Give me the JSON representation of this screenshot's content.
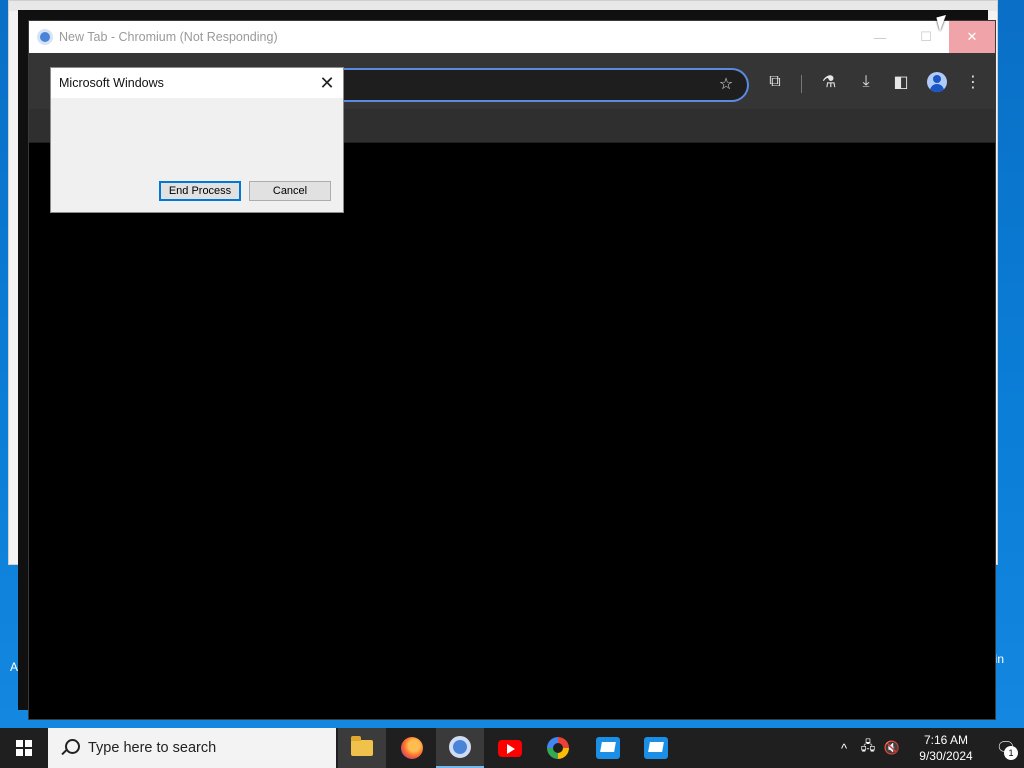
{
  "desktop": {
    "left_edge_text": "A",
    "right_edge_text": "in"
  },
  "chromium": {
    "title": "New Tab - Chromium (Not Responding)",
    "controls": {
      "minimize": "—",
      "maximize": "☐",
      "close": "✕"
    }
  },
  "toolbar": {
    "icons": [
      "star-icon",
      "extensions-icon",
      "labs-icon",
      "download-icon",
      "side-panel-icon",
      "profile-icon",
      "menu-icon"
    ],
    "star": "☆",
    "extensions": "⧉",
    "labs": "⚗",
    "download": "⤓",
    "side_panel": "◧",
    "menu": "⋮"
  },
  "dialog": {
    "title": "Microsoft Windows",
    "close": "✕",
    "end_process_label": "End Process",
    "cancel_label": "Cancel"
  },
  "taskbar": {
    "search_placeholder": "Type here to search",
    "apps": [
      "file-explorer",
      "firefox",
      "chromium",
      "youtube",
      "photos",
      "app-tile",
      "app-tile"
    ],
    "tray": {
      "chevron": "^",
      "network": "🖧",
      "volume": "🔇"
    },
    "time": "7:16 AM",
    "date": "9/30/2024",
    "notifications": "🗨",
    "notification_count": "1"
  }
}
